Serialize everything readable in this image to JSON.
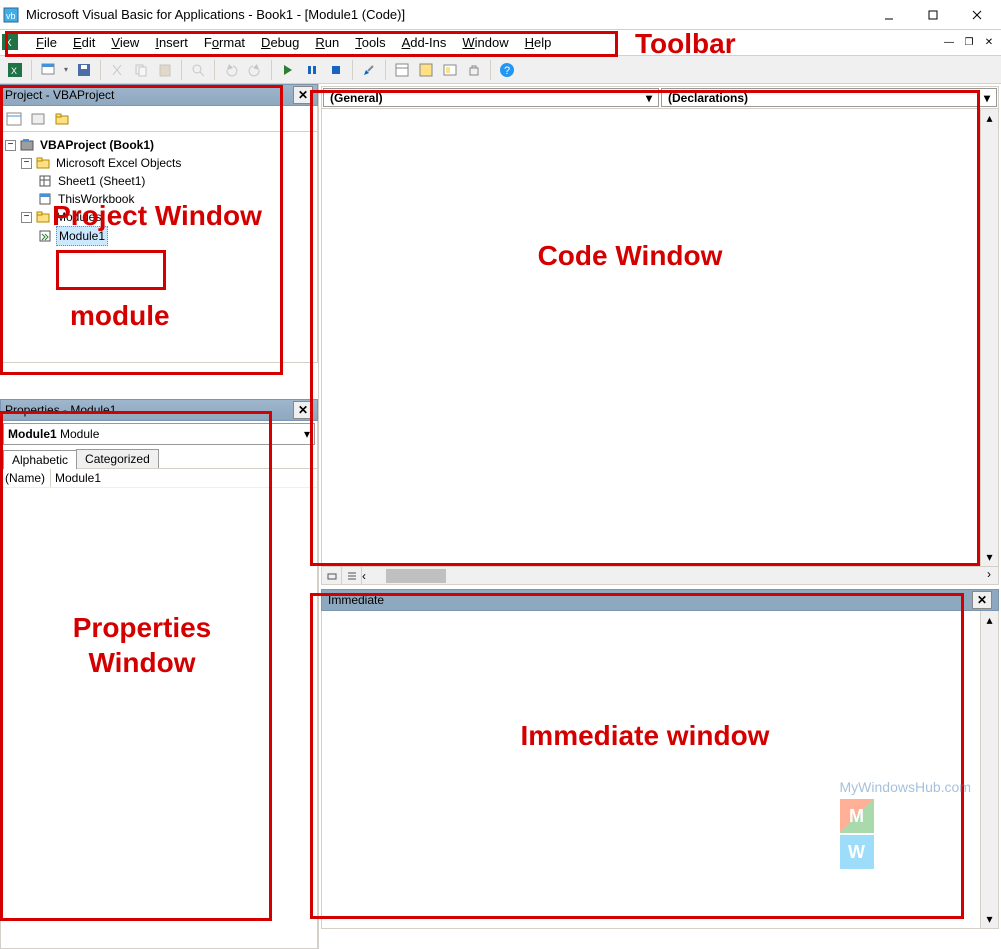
{
  "window": {
    "title": "Microsoft Visual Basic for Applications - Book1 - [Module1 (Code)]"
  },
  "menu": {
    "items": [
      "File",
      "Edit",
      "View",
      "Insert",
      "Format",
      "Debug",
      "Run",
      "Tools",
      "Add-Ins",
      "Window",
      "Help"
    ]
  },
  "project_panel": {
    "title": "Project - VBAProject",
    "root": "VBAProject (Book1)",
    "folder1": "Microsoft Excel Objects",
    "sheet1": "Sheet1 (Sheet1)",
    "workbook": "ThisWorkbook",
    "folder2": "Modules",
    "module": "Module1"
  },
  "props_panel": {
    "title": "Properties - Module1",
    "combo_name": "Module1",
    "combo_type": "Module",
    "tab1": "Alphabetic",
    "tab2": "Categorized",
    "row1_name": "(Name)",
    "row1_val": "Module1"
  },
  "code_panel": {
    "left_dd": "(General)",
    "right_dd": "(Declarations)"
  },
  "immediate_panel": {
    "title": "Immediate"
  },
  "annotations": {
    "toolbar": "Toolbar",
    "project": "Project Window",
    "module": "module",
    "code": "Code Window",
    "props": "Properties\nWindow",
    "immediate": "Immediate window"
  },
  "watermark": "MyWindowsHub.com"
}
